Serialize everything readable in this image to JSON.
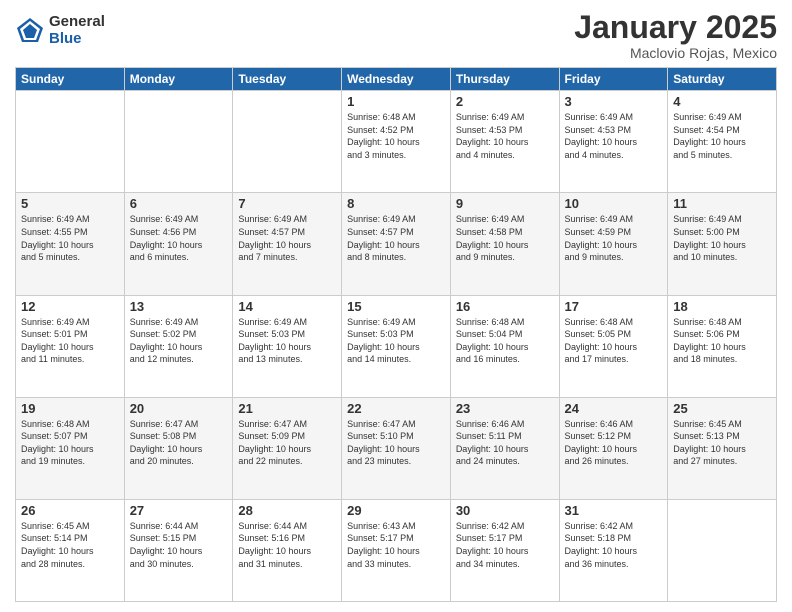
{
  "logo": {
    "general": "General",
    "blue": "Blue"
  },
  "title": "January 2025",
  "location": "Maclovio Rojas, Mexico",
  "days_header": [
    "Sunday",
    "Monday",
    "Tuesday",
    "Wednesday",
    "Thursday",
    "Friday",
    "Saturday"
  ],
  "weeks": [
    [
      {
        "day": "",
        "info": ""
      },
      {
        "day": "",
        "info": ""
      },
      {
        "day": "",
        "info": ""
      },
      {
        "day": "1",
        "info": "Sunrise: 6:48 AM\nSunset: 4:52 PM\nDaylight: 10 hours\nand 3 minutes."
      },
      {
        "day": "2",
        "info": "Sunrise: 6:49 AM\nSunset: 4:53 PM\nDaylight: 10 hours\nand 4 minutes."
      },
      {
        "day": "3",
        "info": "Sunrise: 6:49 AM\nSunset: 4:53 PM\nDaylight: 10 hours\nand 4 minutes."
      },
      {
        "day": "4",
        "info": "Sunrise: 6:49 AM\nSunset: 4:54 PM\nDaylight: 10 hours\nand 5 minutes."
      }
    ],
    [
      {
        "day": "5",
        "info": "Sunrise: 6:49 AM\nSunset: 4:55 PM\nDaylight: 10 hours\nand 5 minutes."
      },
      {
        "day": "6",
        "info": "Sunrise: 6:49 AM\nSunset: 4:56 PM\nDaylight: 10 hours\nand 6 minutes."
      },
      {
        "day": "7",
        "info": "Sunrise: 6:49 AM\nSunset: 4:57 PM\nDaylight: 10 hours\nand 7 minutes."
      },
      {
        "day": "8",
        "info": "Sunrise: 6:49 AM\nSunset: 4:57 PM\nDaylight: 10 hours\nand 8 minutes."
      },
      {
        "day": "9",
        "info": "Sunrise: 6:49 AM\nSunset: 4:58 PM\nDaylight: 10 hours\nand 9 minutes."
      },
      {
        "day": "10",
        "info": "Sunrise: 6:49 AM\nSunset: 4:59 PM\nDaylight: 10 hours\nand 9 minutes."
      },
      {
        "day": "11",
        "info": "Sunrise: 6:49 AM\nSunset: 5:00 PM\nDaylight: 10 hours\nand 10 minutes."
      }
    ],
    [
      {
        "day": "12",
        "info": "Sunrise: 6:49 AM\nSunset: 5:01 PM\nDaylight: 10 hours\nand 11 minutes."
      },
      {
        "day": "13",
        "info": "Sunrise: 6:49 AM\nSunset: 5:02 PM\nDaylight: 10 hours\nand 12 minutes."
      },
      {
        "day": "14",
        "info": "Sunrise: 6:49 AM\nSunset: 5:03 PM\nDaylight: 10 hours\nand 13 minutes."
      },
      {
        "day": "15",
        "info": "Sunrise: 6:49 AM\nSunset: 5:03 PM\nDaylight: 10 hours\nand 14 minutes."
      },
      {
        "day": "16",
        "info": "Sunrise: 6:48 AM\nSunset: 5:04 PM\nDaylight: 10 hours\nand 16 minutes."
      },
      {
        "day": "17",
        "info": "Sunrise: 6:48 AM\nSunset: 5:05 PM\nDaylight: 10 hours\nand 17 minutes."
      },
      {
        "day": "18",
        "info": "Sunrise: 6:48 AM\nSunset: 5:06 PM\nDaylight: 10 hours\nand 18 minutes."
      }
    ],
    [
      {
        "day": "19",
        "info": "Sunrise: 6:48 AM\nSunset: 5:07 PM\nDaylight: 10 hours\nand 19 minutes."
      },
      {
        "day": "20",
        "info": "Sunrise: 6:47 AM\nSunset: 5:08 PM\nDaylight: 10 hours\nand 20 minutes."
      },
      {
        "day": "21",
        "info": "Sunrise: 6:47 AM\nSunset: 5:09 PM\nDaylight: 10 hours\nand 22 minutes."
      },
      {
        "day": "22",
        "info": "Sunrise: 6:47 AM\nSunset: 5:10 PM\nDaylight: 10 hours\nand 23 minutes."
      },
      {
        "day": "23",
        "info": "Sunrise: 6:46 AM\nSunset: 5:11 PM\nDaylight: 10 hours\nand 24 minutes."
      },
      {
        "day": "24",
        "info": "Sunrise: 6:46 AM\nSunset: 5:12 PM\nDaylight: 10 hours\nand 26 minutes."
      },
      {
        "day": "25",
        "info": "Sunrise: 6:45 AM\nSunset: 5:13 PM\nDaylight: 10 hours\nand 27 minutes."
      }
    ],
    [
      {
        "day": "26",
        "info": "Sunrise: 6:45 AM\nSunset: 5:14 PM\nDaylight: 10 hours\nand 28 minutes."
      },
      {
        "day": "27",
        "info": "Sunrise: 6:44 AM\nSunset: 5:15 PM\nDaylight: 10 hours\nand 30 minutes."
      },
      {
        "day": "28",
        "info": "Sunrise: 6:44 AM\nSunset: 5:16 PM\nDaylight: 10 hours\nand 31 minutes."
      },
      {
        "day": "29",
        "info": "Sunrise: 6:43 AM\nSunset: 5:17 PM\nDaylight: 10 hours\nand 33 minutes."
      },
      {
        "day": "30",
        "info": "Sunrise: 6:42 AM\nSunset: 5:17 PM\nDaylight: 10 hours\nand 34 minutes."
      },
      {
        "day": "31",
        "info": "Sunrise: 6:42 AM\nSunset: 5:18 PM\nDaylight: 10 hours\nand 36 minutes."
      },
      {
        "day": "",
        "info": ""
      }
    ]
  ]
}
